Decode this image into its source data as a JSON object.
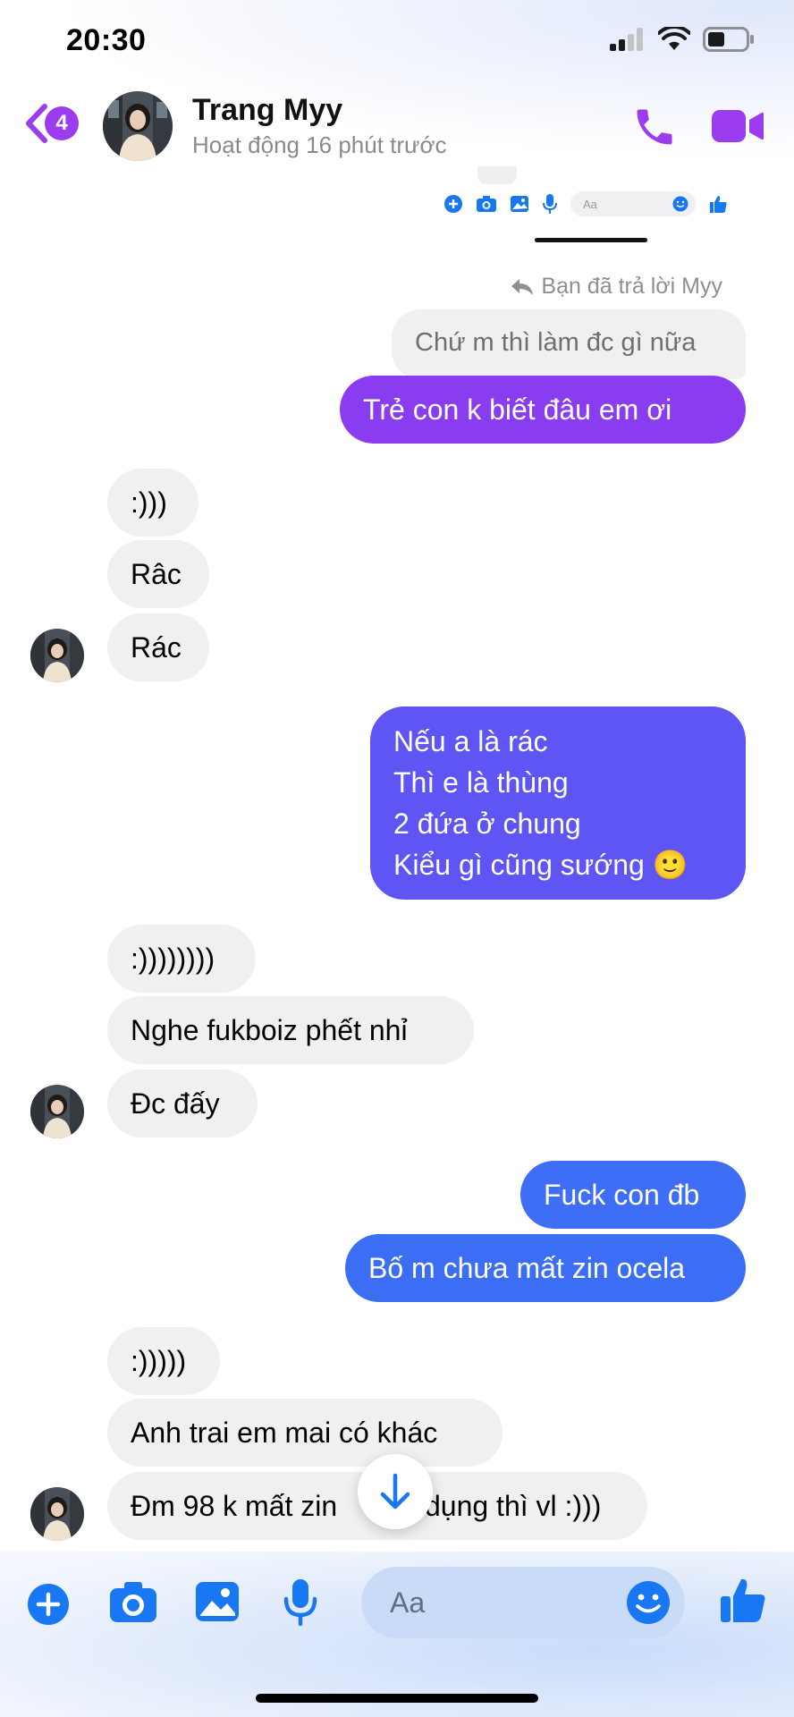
{
  "status": {
    "time": "20:30"
  },
  "header": {
    "unread_count": "4",
    "name": "Trang Myy",
    "activity": "Hoạt động 16 phút trước"
  },
  "embedded": {
    "input_placeholder": "Aa"
  },
  "reply_note": "Bạn đã trả lời Myy",
  "messages": [
    {
      "side": "quoted",
      "text": "Chứ m thì làm đc gì nữa"
    },
    {
      "side": "out",
      "text": "Trẻ con k biết đâu em ơi"
    },
    {
      "side": "in",
      "text": ":)))"
    },
    {
      "side": "in",
      "text": "Râc"
    },
    {
      "side": "in",
      "text": "Rác"
    },
    {
      "side": "out",
      "text": "Nếu a là rác\nThì e là thùng\n2 đứa ở chung\nKiểu gì cũng sướng 🙂"
    },
    {
      "side": "in",
      "text": ":))))))))"
    },
    {
      "side": "in",
      "text": "Nghe fukboiz phết nhỉ"
    },
    {
      "side": "in",
      "text": "Đc đấy"
    },
    {
      "side": "out",
      "text": "Fuck con đb"
    },
    {
      "side": "out",
      "text": "Bố m chưa mất zin ocela"
    },
    {
      "side": "in",
      "text": ":)))))"
    },
    {
      "side": "in",
      "text": "Anh trai em mai có khác"
    },
    {
      "side": "in",
      "text": "Đm 98 k mất zin           dụng thì vl :)))"
    }
  ],
  "composer": {
    "placeholder": "Aa"
  },
  "colors": {
    "accent": "#9b3cf0",
    "out_purple": "#8a3df0",
    "out_violet": "#5e55f4",
    "out_blue": "#3b6ef5",
    "icon_blue": "#1877f2",
    "incoming": "#f0f0f0"
  }
}
